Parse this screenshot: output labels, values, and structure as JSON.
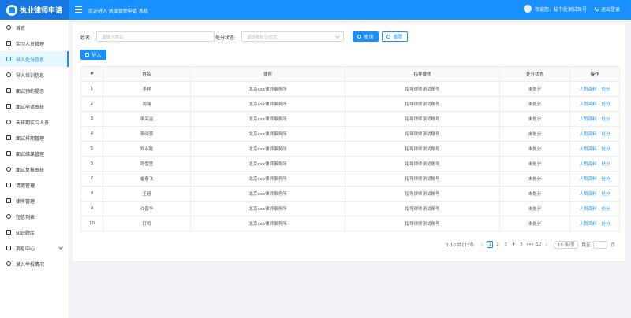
{
  "header": {
    "brand": "执业律师申请",
    "welcome": "欢迎进入 执业律师申请 系统",
    "user_text": "欢迎您，秘书处测试账号",
    "logout": "退出登录"
  },
  "sidebar": {
    "items": [
      {
        "label": "首页",
        "icon": "home-icon"
      },
      {
        "label": "实习人员管理",
        "icon": "user-list-icon"
      },
      {
        "label": "导入处分信息",
        "icon": "import-icon",
        "active": true
      },
      {
        "label": "导入培训信息",
        "icon": "training-icon"
      },
      {
        "label": "面试预约提示",
        "icon": "calendar-icon"
      },
      {
        "label": "面试申请审核",
        "icon": "audit-icon"
      },
      {
        "label": "未排期实习人员",
        "icon": "user-icon"
      },
      {
        "label": "面试排期管理",
        "icon": "schedule-icon"
      },
      {
        "label": "面试结果管理",
        "icon": "result-icon"
      },
      {
        "label": "面试复核审核",
        "icon": "review-icon"
      },
      {
        "label": "请假管理",
        "icon": "leave-icon"
      },
      {
        "label": "律所管理",
        "icon": "firm-icon"
      },
      {
        "label": "短信列表",
        "icon": "sms-icon"
      },
      {
        "label": "知识题库",
        "icon": "question-bank-icon"
      },
      {
        "label": "消息中心",
        "icon": "message-icon",
        "expandable": true
      },
      {
        "label": "录入举报情况",
        "icon": "report-icon"
      }
    ]
  },
  "search": {
    "name_label": "姓名:",
    "name_placeholder": "请输入姓名",
    "status_label": "处分状态:",
    "status_placeholder": "请选择处分状态",
    "search_button": "查询",
    "reset_button": "重置",
    "import_button": "导入"
  },
  "table": {
    "columns": [
      "#",
      "姓名",
      "律所",
      "指导律师",
      "处分状态",
      "操作"
    ],
    "action_info": "人员资料",
    "action_punish": "处分",
    "rows": [
      {
        "no": "1",
        "name": "李祥",
        "firm": "北京xxx律师事务所",
        "mentor": "指导律师测试账号",
        "status": "未处分"
      },
      {
        "no": "2",
        "name": "周瑞",
        "firm": "北京xxx律师事务所",
        "mentor": "指导律师测试账号",
        "status": "未处分"
      },
      {
        "no": "3",
        "name": "李采溢",
        "firm": "北京xxx律师事务所",
        "mentor": "指导律师测试账号",
        "status": "未处分"
      },
      {
        "no": "4",
        "name": "李晓蕾",
        "firm": "北京xxx律师事务所",
        "mentor": "指导律师测试账号",
        "status": "未处分"
      },
      {
        "no": "5",
        "name": "郑永胜",
        "firm": "北京xxx律师事务所",
        "mentor": "指导律师测试账号",
        "status": "未处分"
      },
      {
        "no": "6",
        "name": "符雪莹",
        "firm": "北京xxx律师事务所",
        "mentor": "指导律师测试账号",
        "status": "未处分"
      },
      {
        "no": "7",
        "name": "崔春飞",
        "firm": "北京xxx律师事务所",
        "mentor": "指导律师测试账号",
        "status": "未处分"
      },
      {
        "no": "8",
        "name": "王超",
        "firm": "北京xxx律师事务所",
        "mentor": "指导律师测试账号",
        "status": "未处分"
      },
      {
        "no": "9",
        "name": "许晋华",
        "firm": "北京xxx律师事务所",
        "mentor": "指导律师测试账号",
        "status": "未处分"
      },
      {
        "no": "10",
        "name": "打鸣",
        "firm": "北京xxx律师事务所",
        "mentor": "指导律师测试账号",
        "status": "未处分"
      }
    ]
  },
  "pagination": {
    "summary": "1-10 共112条",
    "prev": "‹",
    "pages": [
      "1",
      "2",
      "3",
      "4",
      "5",
      "•••",
      "12"
    ],
    "current": "1",
    "next": "›",
    "page_size": "10 条/页",
    "jump_label": "跳至",
    "page_suffix": "页"
  },
  "colors": {
    "primary": "#1890ff",
    "header": "#1890ff",
    "background": "#f0f2f5"
  }
}
